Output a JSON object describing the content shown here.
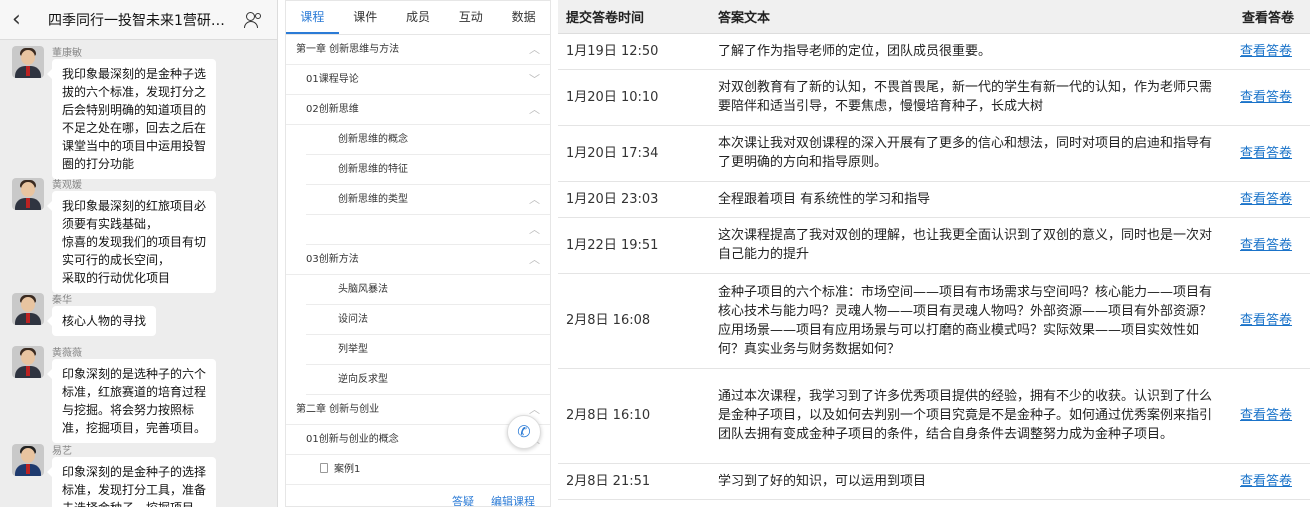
{
  "chat": {
    "title": "四季同行一投智未来1营研讨...",
    "messages": [
      {
        "sender": "董康敏",
        "text": "我印象最深刻的是金种子选\n拔的六个标准，发现打分之\n后会特别明确的知道项目的\n不足之处在哪，回去之后在\n课堂当中的项目中运用投智\n圈的打分功能"
      },
      {
        "sender": "黄观媛",
        "text": "我印象最深刻的红旅项目必\n须要有实践基础，\n惊喜的发现我们的项目有切\n实可行的成长空间，\n采取的行动优化项目"
      },
      {
        "sender": "秦华",
        "text": "核心人物的寻找"
      },
      {
        "sender": "黄薇薇",
        "text": "印象深刻的是选种子的六个\n标准，红旅赛道的培育过程\n与挖掘。将会努力按照标\n准，挖掘项目，完善项目。"
      },
      {
        "sender": "易艺",
        "text": "印象深刻的是金种子的选择\n标准，发现打分工具，准备\n去选择金种子，挖掘项目"
      }
    ]
  },
  "course": {
    "tabs": [
      "课程",
      "课件",
      "成员",
      "互动",
      "数据"
    ],
    "outline": [
      {
        "level": 0,
        "label": "第一章 创新思维与方法",
        "chevron": "up"
      },
      {
        "level": 1,
        "label": "01课程导论",
        "chevron": "down"
      },
      {
        "level": 1,
        "label": "02创新思维",
        "chevron": "up"
      },
      {
        "level": 2,
        "label": "创新思维的概念",
        "chevron": ""
      },
      {
        "level": 2,
        "label": "创新思维的特征",
        "chevron": ""
      },
      {
        "level": 2,
        "label": "创新思维的类型",
        "chevron": "up"
      },
      {
        "level": 2,
        "label": "",
        "chevron": "up"
      },
      {
        "level": 1,
        "label": "03创新方法",
        "chevron": "up"
      },
      {
        "level": 2,
        "label": "头脑风暴法",
        "chevron": ""
      },
      {
        "level": 2,
        "label": "设问法",
        "chevron": ""
      },
      {
        "level": 2,
        "label": "列举型",
        "chevron": ""
      },
      {
        "level": 2,
        "label": "逆向反求型",
        "chevron": ""
      },
      {
        "level": 0,
        "label": "第二章 创新与创业",
        "chevron": "up"
      },
      {
        "level": 1,
        "label": "01创新与创业的概念",
        "chevron": "up"
      },
      {
        "level": 3,
        "label": "案例1",
        "chevron": ""
      }
    ],
    "footer": {
      "qa": "答疑",
      "edit": "编辑课程"
    }
  },
  "answers": {
    "headers": [
      "提交答卷时间",
      "答案文本",
      "查看答卷"
    ],
    "rows": [
      {
        "time": "1月19日 12:50",
        "text": "了解了作为指导老师的定位，团队成员很重要。",
        "link": "查看答卷"
      },
      {
        "time": "1月20日 10:10",
        "text": "对双创教育有了新的认知，不畏首畏尾，新一代的学生有新一代的认知，作为老师只需要陪伴和适当引导，不要焦虑，慢慢培育种子，长成大树",
        "link": "查看答卷"
      },
      {
        "time": "1月20日 17:34",
        "text": "本次课让我对双创课程的深入开展有了更多的信心和想法，同时对项目的启迪和指导有了更明确的方向和指导原则。",
        "link": "查看答卷"
      },
      {
        "time": "1月20日 23:03",
        "text": "全程跟着项目 有系统性的学习和指导",
        "link": "查看答卷"
      },
      {
        "time": "1月22日 19:51",
        "text": "这次课程提高了我对双创的理解，也让我更全面认识到了双创的意义，同时也是一次对自己能力的提升",
        "link": "查看答卷"
      },
      {
        "time": "2月8日 16:08",
        "text": "金种子项目的六个标准：市场空间——项目有市场需求与空间吗？核心能力——项目有核心技术与能力吗？灵魂人物——项目有灵魂人物吗？外部资源——项目有外部资源？应用场景——项目有应用场景与可以打磨的商业模式吗？实际效果——项目实效性如何？真实业务与财务数据如何？",
        "link": "查看答卷"
      },
      {
        "time": "2月8日 16:10",
        "text": "通过本次课程，我学习到了许多优秀项目提供的经验，拥有不少的收获。认识到了什么是金种子项目，以及如何去判别一个项目究竟是不是金种子。如何通过优秀案例来指引团队去拥有变成金种子项目的条件，结合自身条件去调整努力成为金种子项目。",
        "link": "查看答卷"
      },
      {
        "time": "2月8日 21:51",
        "text": "学习到了好的知识，可以运用到项目",
        "link": "查看答卷"
      }
    ]
  },
  "colors": {
    "accent": "#2b7bd6",
    "link": "#1a73c9",
    "chat_bg": "#ededed",
    "header_bg": "#f0f0f0"
  }
}
